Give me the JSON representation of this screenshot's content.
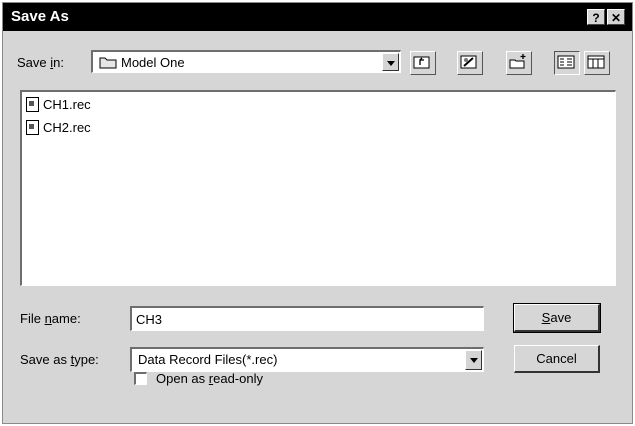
{
  "window": {
    "title": "Save As",
    "help_label": "?",
    "close_label": "✕"
  },
  "save_in": {
    "label_pre": "Save ",
    "label_key": "i",
    "label_post": "n:",
    "folder": "Model One",
    "folder_icon": "folder-icon"
  },
  "toolbar": {
    "icons": [
      "up-folder-icon",
      "desktop-icon",
      "new-folder-icon",
      "list-view-icon",
      "details-view-icon"
    ]
  },
  "files": [
    {
      "name": "CH1.rec",
      "icon": "document-icon"
    },
    {
      "name": "CH2.rec",
      "icon": "document-icon"
    }
  ],
  "file_name": {
    "label_pre": "File ",
    "label_key": "n",
    "label_post": "ame:",
    "value": "CH3"
  },
  "save_type": {
    "label_pre": "Save as ",
    "label_key": "t",
    "label_post": "ype:",
    "value": "Data Record Files(*.rec)"
  },
  "buttons": {
    "save_key": "S",
    "save_rest": "ave",
    "cancel": "Cancel"
  },
  "read_only": {
    "label_pre": "Open as ",
    "label_key": "r",
    "label_post": "ead-only",
    "checked": false
  }
}
